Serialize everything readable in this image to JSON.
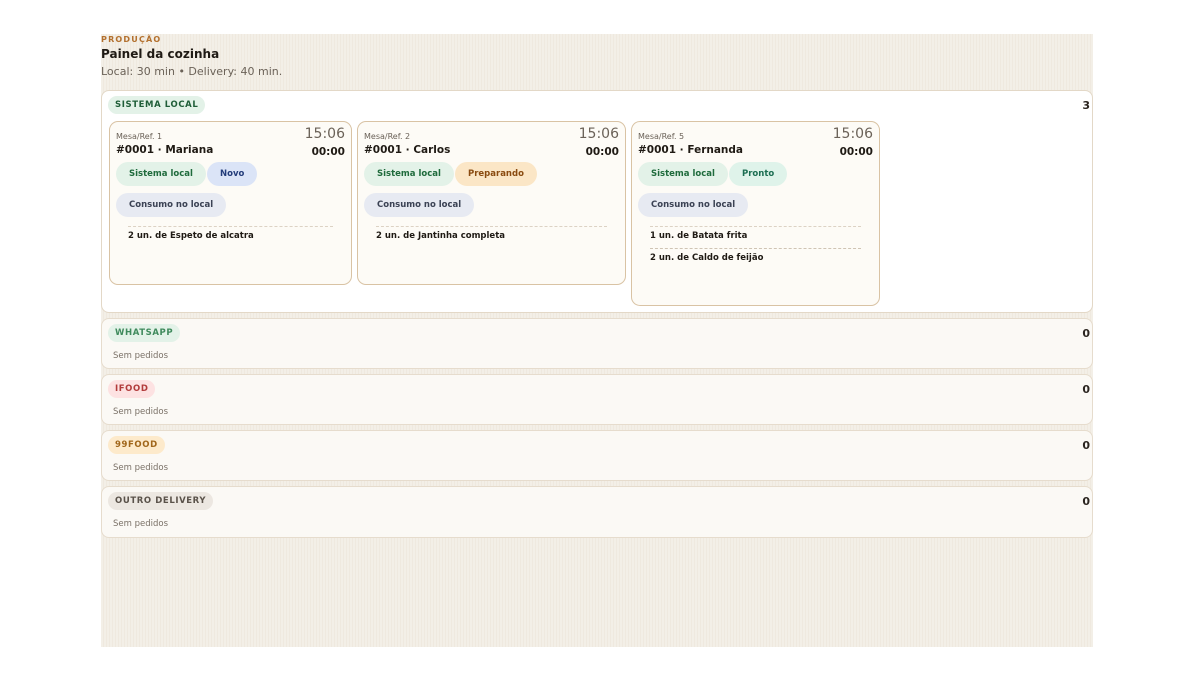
{
  "header": {
    "eyebrow": "PRODUÇÃO",
    "title": "Painel da cozinha",
    "subtitle": "Local: 30 min • Delivery: 40 min."
  },
  "colors": {
    "accent": "#b3702e",
    "sistema_local": "#e3f2e8",
    "whatsapp": "#e3f2e8",
    "ifood": "#fde2e2",
    "99food": "#fdeacb",
    "outro_delivery": "#ece7e1"
  },
  "sections": {
    "sistema_local": {
      "label": "SISTEMA LOCAL",
      "count": "3",
      "orders": [
        {
          "ref": "Mesa/Ref. 1",
          "time": "15:06",
          "order": "#0001 · Mariana",
          "elapsed": "00:00",
          "channel": "Sistema local",
          "status": "Novo",
          "mode": "Consumo no local",
          "items": [
            "2 un. de Espeto de alcatra"
          ]
        },
        {
          "ref": "Mesa/Ref. 2",
          "time": "15:06",
          "order": "#0001 · Carlos",
          "elapsed": "00:00",
          "channel": "Sistema local",
          "status": "Preparando",
          "mode": "Consumo no local",
          "items": [
            "2 un. de Jantinha completa"
          ]
        },
        {
          "ref": "Mesa/Ref. 5",
          "time": "15:06",
          "order": "#0001 · Fernanda",
          "elapsed": "00:00",
          "channel": "Sistema local",
          "status": "Pronto",
          "mode": "Consumo no local",
          "items": [
            "1 un. de Batata frita",
            "2 un. de Caldo de feijão"
          ]
        }
      ]
    },
    "whatsapp": {
      "label": "WHATSAPP",
      "count": "0",
      "empty": "Sem pedidos"
    },
    "ifood": {
      "label": "IFOOD",
      "count": "0",
      "empty": "Sem pedidos"
    },
    "food99": {
      "label": "99FOOD",
      "count": "0",
      "empty": "Sem pedidos"
    },
    "outro": {
      "label": "OUTRO DELIVERY",
      "count": "0",
      "empty": "Sem pedidos"
    }
  }
}
